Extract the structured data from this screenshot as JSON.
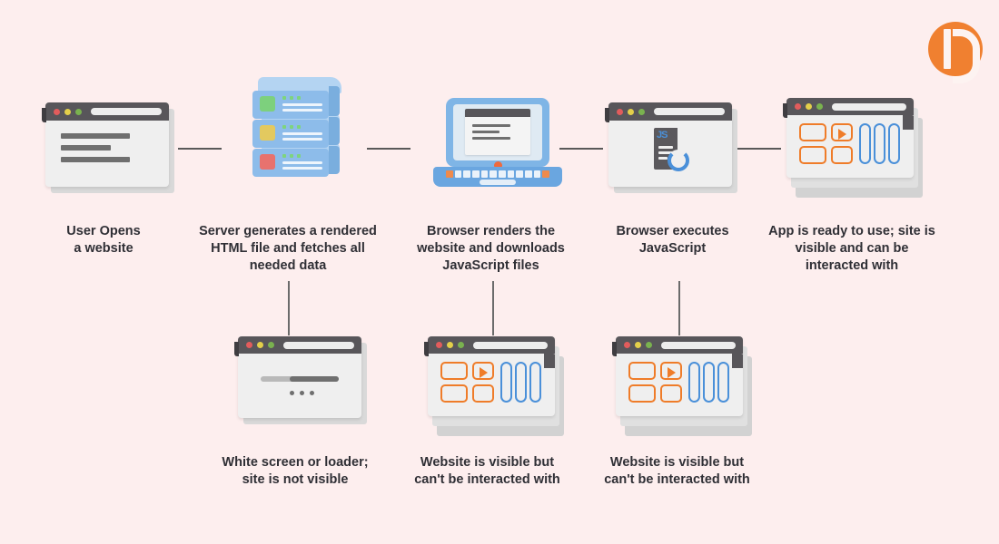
{
  "page": {
    "background_color": "#fdeeee",
    "text_color": "#2f2f35",
    "accent_orange": "#ef7c29",
    "accent_blue": "#4a90d9",
    "logo_color": "#f08030"
  },
  "logo": {
    "name": "brand-logo-b"
  },
  "diagram": {
    "type": "flow",
    "top_steps": [
      {
        "id": "user-opens",
        "icon": "browser-window-text",
        "caption": "User Opens\na website"
      },
      {
        "id": "server-render",
        "icon": "server-stack",
        "caption": "Server generates a rendered\nHTML file and fetches all\nneeded data"
      },
      {
        "id": "browser-render",
        "icon": "laptop-browser",
        "caption": "Browser renders the\nwebsite and downloads\nJavaScript files"
      },
      {
        "id": "execute-js",
        "icon": "browser-window-js-loading",
        "caption": "Browser executes\nJavaScript"
      },
      {
        "id": "app-ready",
        "icon": "browser-window-app-ready",
        "caption": "App is ready to use; site is\nvisible and can be\ninteracted with"
      }
    ],
    "bottom_steps": [
      {
        "id": "white-screen",
        "icon": "browser-window-loader",
        "caption": "White screen or loader;\nsite is not visible"
      },
      {
        "id": "visible-not-interactive-1",
        "icon": "browser-window-app-ready",
        "caption": "Website is visible but\ncan't be interacted with"
      },
      {
        "id": "visible-not-interactive-2",
        "icon": "browser-window-app-ready",
        "caption": "Website is visible but\ncan't be interacted with"
      }
    ]
  },
  "window_dots": {
    "red": "#e25c5c",
    "yellow": "#e3cf4a",
    "green": "#7ab24f"
  }
}
